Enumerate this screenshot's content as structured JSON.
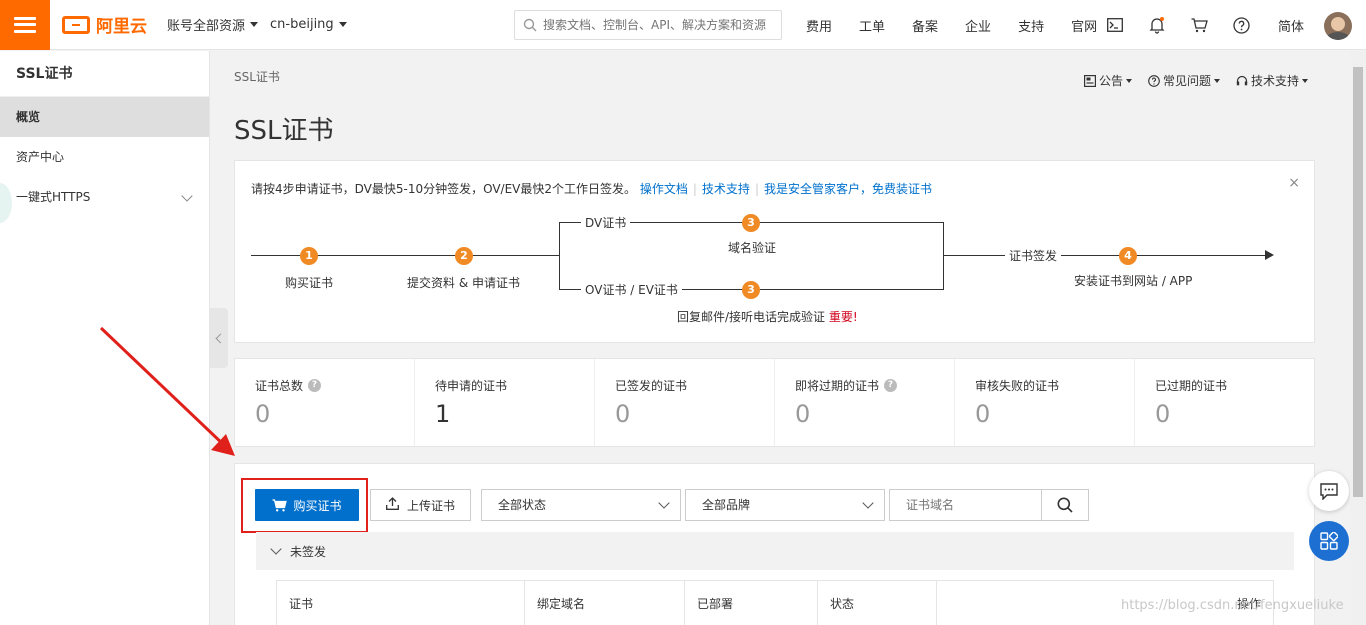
{
  "topbar": {
    "logo": "阿里云",
    "account_dropdown": "账号全部资源",
    "region_dropdown": "cn-beijing",
    "search_placeholder": "搜索文档、控制台、API、解决方案和资源",
    "links": [
      "费用",
      "工单",
      "备案",
      "企业",
      "支持",
      "官网"
    ],
    "language": "简体",
    "icons": [
      "terminal-icon",
      "bell-icon",
      "cart-icon",
      "help-icon"
    ]
  },
  "sidebar": {
    "title": "SSL证书",
    "items": [
      {
        "label": "概览",
        "active": true
      },
      {
        "label": "资产中心",
        "active": false
      },
      {
        "label": "一键式HTTPS",
        "active": false
      }
    ]
  },
  "breadcrumb": "SSL证书",
  "help_links": [
    "公告",
    "常见问题",
    "技术支持"
  ],
  "page_title": "SSL证书",
  "steps": {
    "intro": "请按4步申请证书，DV最快5-10分钟签发，OV/EV最快2个工作日签发。",
    "links": [
      "操作文档",
      "技术支持",
      "我是安全管家客户，免费装证书"
    ],
    "close": "×",
    "step1": {
      "num": "1",
      "label": "购买证书"
    },
    "step2": {
      "num": "2",
      "label": "提交资料 & 申请证书"
    },
    "dv_label": "DV证书",
    "ov_label": "OV证书 / EV证书",
    "step3_dv": {
      "num": "3",
      "label": "域名验证"
    },
    "step3_ov": {
      "num": "3",
      "label": "回复邮件/接听电话完成验证",
      "important": "重要!"
    },
    "issue_label": "证书签发",
    "step4": {
      "num": "4",
      "label": "安装证书到网站 / APP"
    }
  },
  "stats": [
    {
      "label": "证书总数",
      "value": "0",
      "help": true
    },
    {
      "label": "待申请的证书",
      "value": "1",
      "help": false
    },
    {
      "label": "已签发的证书",
      "value": "0",
      "help": false
    },
    {
      "label": "即将过期的证书",
      "value": "0",
      "help": true
    },
    {
      "label": "审核失败的证书",
      "value": "0",
      "help": false
    },
    {
      "label": "已过期的证书",
      "value": "0",
      "help": false
    }
  ],
  "toolbar": {
    "buy_label": "购买证书",
    "upload_label": "上传证书",
    "status_select": "全部状态",
    "brand_select": "全部品牌",
    "domain_placeholder": "证书域名"
  },
  "group": {
    "label": "未签发"
  },
  "table": {
    "columns": [
      "证书",
      "绑定域名",
      "已部署",
      "状态",
      "操作"
    ]
  },
  "watermark": "https://blog.csdn.net/fengxueliuke",
  "colors": {
    "brand": "#ff6a00",
    "primary": "#0070cc",
    "step_badge": "#f08a24",
    "highlight": "#e0201b"
  }
}
